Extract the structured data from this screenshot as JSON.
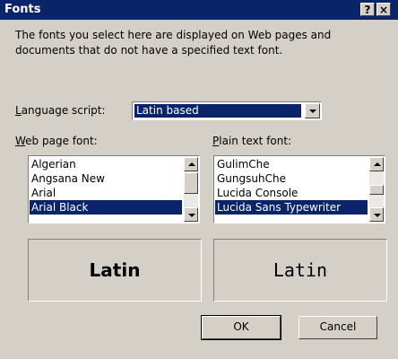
{
  "dialog": {
    "title": "Fonts",
    "help_label": "?",
    "close_label": "×"
  },
  "description": "The fonts you select here are displayed on Web pages and documents that do not have a specified text font.",
  "language": {
    "label_hotkey": "L",
    "label_rest": "anguage script:",
    "value": "Latin based"
  },
  "web_font": {
    "label_hotkey": "W",
    "label_rest": "eb page font:",
    "items": [
      "Algerian",
      "Angsana New",
      "Arial",
      "Arial Black"
    ],
    "selected": "Arial Black",
    "preview": "Latin"
  },
  "plain_font": {
    "label_hotkey": "P",
    "label_rest": "lain text font:",
    "items": [
      "GulimChe",
      "GungsuhChe",
      "Lucida Console",
      "Lucida Sans Typewriter"
    ],
    "selected": "Lucida Sans Typewriter",
    "preview": "Latin"
  },
  "buttons": {
    "ok": "OK",
    "cancel": "Cancel"
  },
  "colors": {
    "titlebar": "#0a246a",
    "face": "#d4d0c8",
    "selection": "#0a246a"
  }
}
